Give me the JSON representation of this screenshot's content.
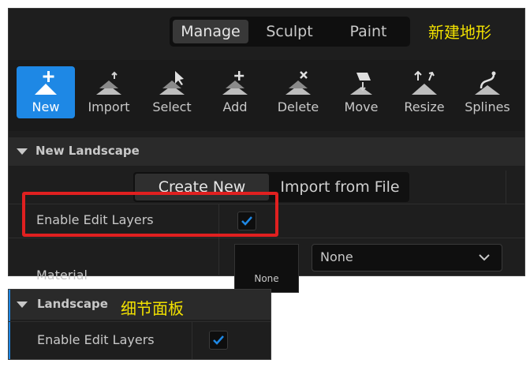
{
  "mode_tabs": [
    {
      "label": "Manage",
      "active": true
    },
    {
      "label": "Sculpt",
      "active": false
    },
    {
      "label": "Paint",
      "active": false
    }
  ],
  "annotation_top": "新建地形",
  "annotation_bottom": "细节面板",
  "tools": [
    {
      "label": "New",
      "icon": "new-landscape-icon",
      "active": true
    },
    {
      "label": "Import",
      "icon": "import-icon",
      "active": false
    },
    {
      "label": "Select",
      "icon": "select-icon",
      "active": false
    },
    {
      "label": "Add",
      "icon": "add-icon",
      "active": false
    },
    {
      "label": "Delete",
      "icon": "delete-icon",
      "active": false
    },
    {
      "label": "Move",
      "icon": "move-icon",
      "active": false
    },
    {
      "label": "Resize",
      "icon": "resize-icon",
      "active": false
    },
    {
      "label": "Splines",
      "icon": "splines-icon",
      "active": false
    }
  ],
  "new_landscape": {
    "title": "New Landscape",
    "sub_tabs": [
      {
        "label": "Create New",
        "active": true
      },
      {
        "label": "Import from File",
        "active": false
      }
    ],
    "enable_edit_layers_label": "Enable Edit Layers",
    "enable_edit_layers_checked": true,
    "material_label": "Material",
    "material_thumb_text": "None",
    "material_value": "None"
  },
  "landscape": {
    "title": "Landscape",
    "enable_edit_layers_label": "Enable Edit Layers",
    "enable_edit_layers_checked": true
  },
  "colors": {
    "accent": "#1e88e5",
    "highlight": "#e02020",
    "annotation": "#f2e100",
    "panel_bg": "#1e1e1e"
  }
}
